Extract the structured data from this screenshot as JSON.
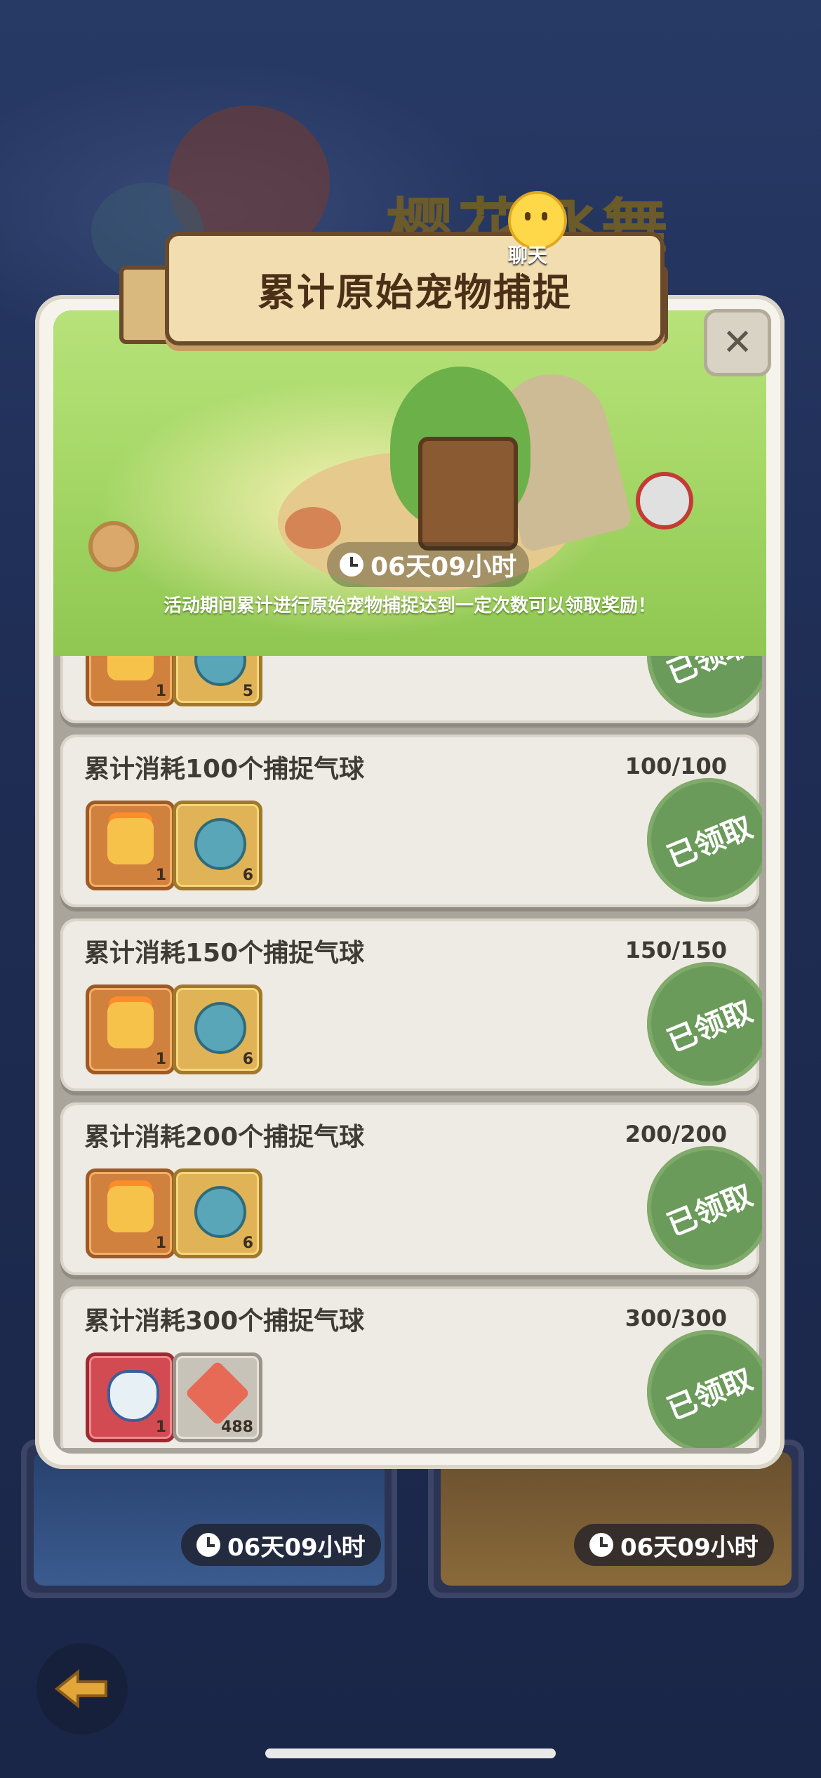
{
  "background": {
    "event_title": "樱花飞舞",
    "card_timers": [
      "06天09小时",
      "06天09小时"
    ]
  },
  "dialog": {
    "title": "累计原始宠物捕捉",
    "chat_label": "聊天",
    "close_label": "✕",
    "timer": "06天09小时",
    "description": "活动期间累计进行原始宠物捕捉达到一定次数可以领取奖励！"
  },
  "tasks": [
    {
      "title": "",
      "progress": "",
      "claimed_label": "已领取",
      "rewards": [
        {
          "icon": "chest-icon",
          "count": "1"
        },
        {
          "icon": "flask-icon",
          "count": "5"
        }
      ]
    },
    {
      "title": "累计消耗100个捕捉气球",
      "progress": "100/100",
      "claimed_label": "已领取",
      "rewards": [
        {
          "icon": "chest-icon",
          "count": "1"
        },
        {
          "icon": "flask-icon",
          "count": "6"
        }
      ]
    },
    {
      "title": "累计消耗150个捕捉气球",
      "progress": "150/150",
      "claimed_label": "已领取",
      "rewards": [
        {
          "icon": "chest-icon",
          "count": "1"
        },
        {
          "icon": "flask-icon",
          "count": "6"
        }
      ]
    },
    {
      "title": "累计消耗200个捕捉气球",
      "progress": "200/200",
      "claimed_label": "已领取",
      "rewards": [
        {
          "icon": "chest-icon",
          "count": "1"
        },
        {
          "icon": "flask-icon",
          "count": "6"
        }
      ]
    },
    {
      "title": "累计消耗300个捕捉气球",
      "progress": "300/300",
      "claimed_label": "已领取",
      "rewards": [
        {
          "icon": "pet-icon",
          "count": "1"
        },
        {
          "icon": "starfish-icon",
          "count": "488"
        }
      ]
    }
  ],
  "colors": {
    "claimed_stamp": "#6b9b5a",
    "banner_green": "#a6d867",
    "ribbon": "#f1ddb0"
  }
}
